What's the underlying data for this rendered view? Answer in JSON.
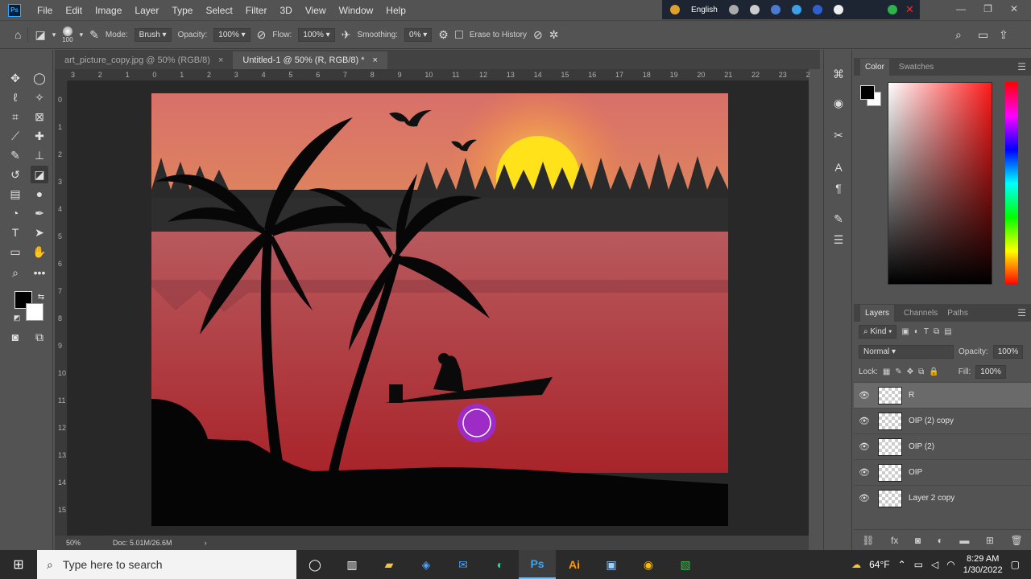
{
  "menubar": {
    "logo": "Ps",
    "items": [
      "File",
      "Edit",
      "Image",
      "Layer",
      "Type",
      "Select",
      "Filter",
      "3D",
      "View",
      "Window",
      "Help"
    ],
    "language": "English"
  },
  "options": {
    "brush_size": "100",
    "mode_label": "Mode:",
    "mode_value": "Brush",
    "opacity_label": "Opacity:",
    "opacity_value": "100%",
    "flow_label": "Flow:",
    "flow_value": "100%",
    "smoothing_label": "Smoothing:",
    "smoothing_value": "0%",
    "erase_history_label": "Erase to History"
  },
  "tabs": [
    {
      "label": "art_picture_copy.jpg @ 50% (RGB/8)",
      "close": "×"
    },
    {
      "label": "Untitled-1 @ 50% (R, RGB/8) *",
      "close": "×"
    }
  ],
  "ruler": {
    "h_ticks": [
      "3",
      "2",
      "1",
      "0",
      "1",
      "2",
      "3",
      "4",
      "5",
      "6",
      "7",
      "8",
      "9",
      "10",
      "11",
      "12",
      "13",
      "14",
      "15",
      "16",
      "17",
      "18",
      "19",
      "20",
      "21",
      "22",
      "23",
      "2"
    ],
    "v_ticks": [
      "0",
      "1",
      "2",
      "3",
      "4",
      "5",
      "6",
      "7",
      "8",
      "9",
      "10",
      "11",
      "12",
      "13",
      "14",
      "15"
    ]
  },
  "status": {
    "zoom": "50%",
    "doc": "Doc: 5.01M/26.6M"
  },
  "color_panel": {
    "tabs": [
      "Color",
      "Swatches"
    ],
    "foreground": "#000000",
    "background": "#ffffff",
    "hue": "#ff1a1a"
  },
  "layers_panel": {
    "tabs": [
      "Layers",
      "Channels",
      "Paths"
    ],
    "filter_label": "Kind",
    "blend_mode": "Normal",
    "opacity_label": "Opacity:",
    "opacity_value": "100%",
    "lock_label": "Lock:",
    "fill_label": "Fill:",
    "fill_value": "100%",
    "layers": [
      {
        "name": "R",
        "selected": true
      },
      {
        "name": "OIP (2) copy",
        "selected": false
      },
      {
        "name": "OIP (2)",
        "selected": false
      },
      {
        "name": "OIP",
        "selected": false
      },
      {
        "name": "Layer 2 copy",
        "selected": false
      }
    ]
  },
  "taskbar": {
    "search_placeholder": "Type here to search",
    "weather": "64°F",
    "time": "8:29 AM",
    "date": "1/30/2022"
  }
}
